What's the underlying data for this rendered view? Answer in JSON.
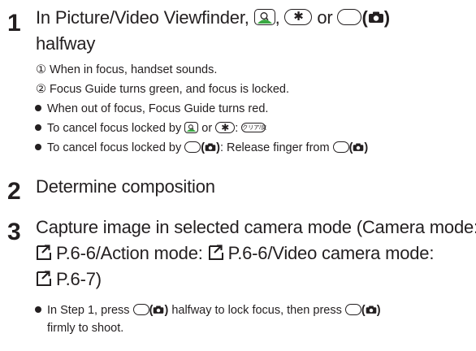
{
  "step1": {
    "number": "1",
    "line1_pre": "In Picture/Video Viewfinder,",
    "comma": ",",
    "or": "or",
    "line2": "halfway",
    "sub1": "① When in focus, handset sounds.",
    "sub2": "② Focus Guide turns green, and focus is locked.",
    "bullet1": "When out of focus, Focus Guide turns red.",
    "bullet2_pre": "To cancel focus locked by",
    "bullet2_or": "or",
    "bullet2_colon": ":",
    "clear_key_label": "クリア/戻",
    "bullet3_pre": "To cancel focus locked by",
    "bullet3_mid": ": Release finger from"
  },
  "step2": {
    "number": "2",
    "text": "Determine composition"
  },
  "step3": {
    "number": "3",
    "line1": "Capture image in selected camera mode (Camera mode:",
    "line2_ref1": "P.6-6/Action mode:",
    "line2_ref2": "P.6-6/Video camera mode:",
    "line3_ref3": "P.6-7)",
    "bullet1_pre": "In Step 1, press",
    "bullet1_mid": "halfway to lock focus, then press",
    "bullet1_line2": "firmly to shoot."
  },
  "icons": {
    "magnifier_key": "magnifier-key-icon",
    "star_key": "asterisk-key-icon",
    "side_key": "side-key-icon",
    "camera": "camera-icon",
    "reference": "page-reference-icon"
  },
  "colors": {
    "magnifier_green": "#3aa843",
    "text": "#231f20"
  }
}
